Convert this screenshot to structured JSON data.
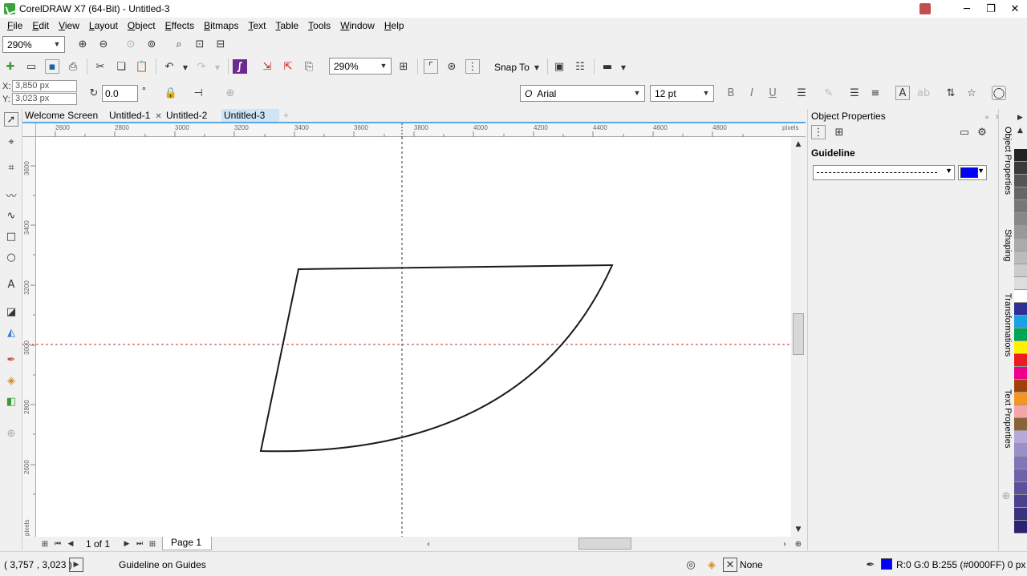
{
  "title": "CorelDRAW X7 (64-Bit) - Untitled-3",
  "menu": [
    "File",
    "Edit",
    "View",
    "Layout",
    "Object",
    "Effects",
    "Bitmaps",
    "Text",
    "Table",
    "Tools",
    "Window",
    "Help"
  ],
  "toolbar1": {
    "zoom": "290%"
  },
  "toolbar2": {
    "zoom": "290%",
    "snap_to": "Snap To"
  },
  "propbar": {
    "x": "3,850 px",
    "y": "3,023 px",
    "x_label": "X:",
    "y_label": "Y:",
    "angle": "0.0",
    "degree": "°",
    "font": "Arial",
    "font_size": "12 pt"
  },
  "doc_tabs": [
    "Welcome Screen",
    "Untitled-1",
    "Untitled-2",
    "Untitled-3"
  ],
  "ruler": {
    "top_labels": [
      "2600",
      "2800",
      "3000",
      "3200",
      "3400",
      "3600",
      "3800",
      "4000",
      "4200",
      "4400",
      "4600",
      "4800"
    ],
    "unit": "pixels",
    "left_labels": [
      "3600",
      "3400",
      "3200",
      "3000",
      "2800",
      "2600"
    ],
    "left_unit": "pixels"
  },
  "page_nav": {
    "counter": "1 of 1",
    "page_tab": "Page 1"
  },
  "docker": {
    "title": "Object Properties",
    "section": "Guideline",
    "line_color": "#0000FF"
  },
  "side_tabs": [
    "Object Properties",
    "Shaping",
    "Transformations",
    "Text Properties"
  ],
  "palette": [
    "#222222",
    "#3a3a3a",
    "#555555",
    "#666666",
    "#777777",
    "#888888",
    "#999999",
    "#aaaaaa",
    "#bbbbbb",
    "#cccccc",
    "#dddddd",
    "#ffffff",
    "#2e3192",
    "#1ba1e2",
    "#00a651",
    "#fff200",
    "#ed1c24",
    "#ec008c",
    "#a0410d",
    "#f7941d",
    "#f4a6a6",
    "#8c6239",
    "#b7a8d6",
    "#9b8fc7",
    "#8175b8",
    "#6e62a8",
    "#5c519a",
    "#4b418c",
    "#3a327e",
    "#2a2470"
  ],
  "status": {
    "cursor": "( 3,757 , 3,023 )",
    "message": "Guideline on Guides",
    "fill": "None",
    "outline": "R:0 G:0 B:255 (#0000FF)  0 px",
    "outline_color": "#0000FF"
  }
}
